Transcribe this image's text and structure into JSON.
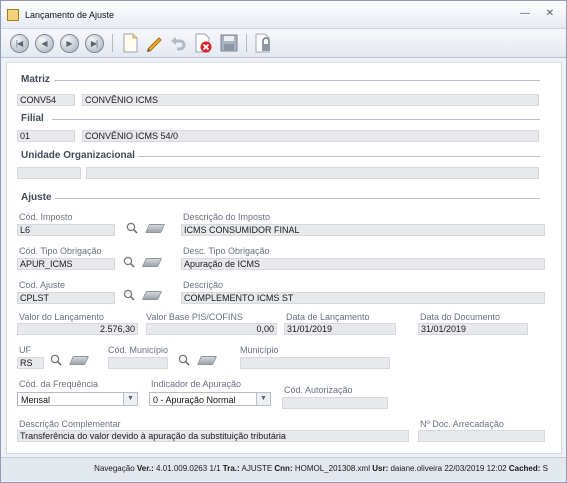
{
  "window": {
    "title": "Lançamento de Ajuste",
    "minimize_icon": "minimize-icon",
    "close_icon": "close-icon"
  },
  "toolbar": {
    "buttons": [
      "first-record-icon",
      "previous-record-icon",
      "next-record-icon",
      "last-record-icon",
      "new-document-icon",
      "edit-pencil-icon",
      "undo-icon",
      "delete-icon",
      "save-icon",
      "lock-icon"
    ]
  },
  "matriz": {
    "section_title": "Matriz",
    "code": "CONV54",
    "description": "CONVÊNIO ICMS"
  },
  "filial": {
    "section_title": "Filial",
    "code": "01",
    "description": "CONVÊNIO ICMS 54/0"
  },
  "unidade": {
    "section_title": "Unidade Organizacional",
    "code": "",
    "description": ""
  },
  "ajuste": {
    "section_title": "Ajuste",
    "cod_imposto_label": "Cód. Imposto",
    "cod_imposto": "L6",
    "descricao_imposto_label": "Descrição do Imposto",
    "descricao_imposto": "ICMS CONSUMIDOR FINAL",
    "cod_tipo_obrigacao_label": "Cód. Tipo Obrigação",
    "cod_tipo_obrigacao": "APUR_ICMS",
    "desc_tipo_obrigacao_label": "Desc. Tipo Obrigação",
    "desc_tipo_obrigacao": "Apuração de ICMS",
    "cod_ajuste_label": "Cod. Ajuste",
    "cod_ajuste": "CPLST",
    "descricao_label": "Descrição",
    "descricao": "COMPLEMENTO ICMS ST",
    "valor_lancamento_label": "Valor do Lançamento",
    "valor_lancamento": "2.576,30",
    "valor_base_label": "Valor Base PIS/COFINS",
    "valor_base": "0,00",
    "data_lancamento_label": "Data de Lançamento",
    "data_lancamento": "31/01/2019",
    "data_documento_label": "Data do Documento",
    "data_documento": "31/01/2019",
    "uf_label": "UF",
    "uf": "RS",
    "cod_municipio_label": "Cód. Município",
    "cod_municipio": "",
    "municipio_label": "Município",
    "municipio": "",
    "cod_frequencia_label": "Cód. da Frequência",
    "cod_frequencia": "Mensal",
    "indicador_apuracao_label": "Indicador de Apuração",
    "indicador_apuracao": "0 - Apuração Normal",
    "cod_autorizacao_label": "Cód. Autorização",
    "cod_autorizacao": "",
    "descricao_complementar_label": "Descrição Complementar",
    "descricao_complementar": "Transferência do valor devido à apuração da substituição tributária",
    "num_doc_arrecadacao_label": "Nº Doc. Arrecadação",
    "num_doc_arrecadacao": ""
  },
  "status": {
    "navigation_label": "Navegação",
    "ver_label": "Ver.:",
    "ver_value": "4.01.009.0263",
    "page": "1/1",
    "tra_label": "Tra.:",
    "tra_value": "AJUSTE",
    "cnn_label": "Cnn:",
    "cnn_value": "HOMOL_201308.xml",
    "usr_label": "Usr:",
    "usr_value": "daiane.oliveira",
    "date": "22/03/2019",
    "time": "12:02",
    "cached_label": "Cached:",
    "cached_value": "S"
  }
}
